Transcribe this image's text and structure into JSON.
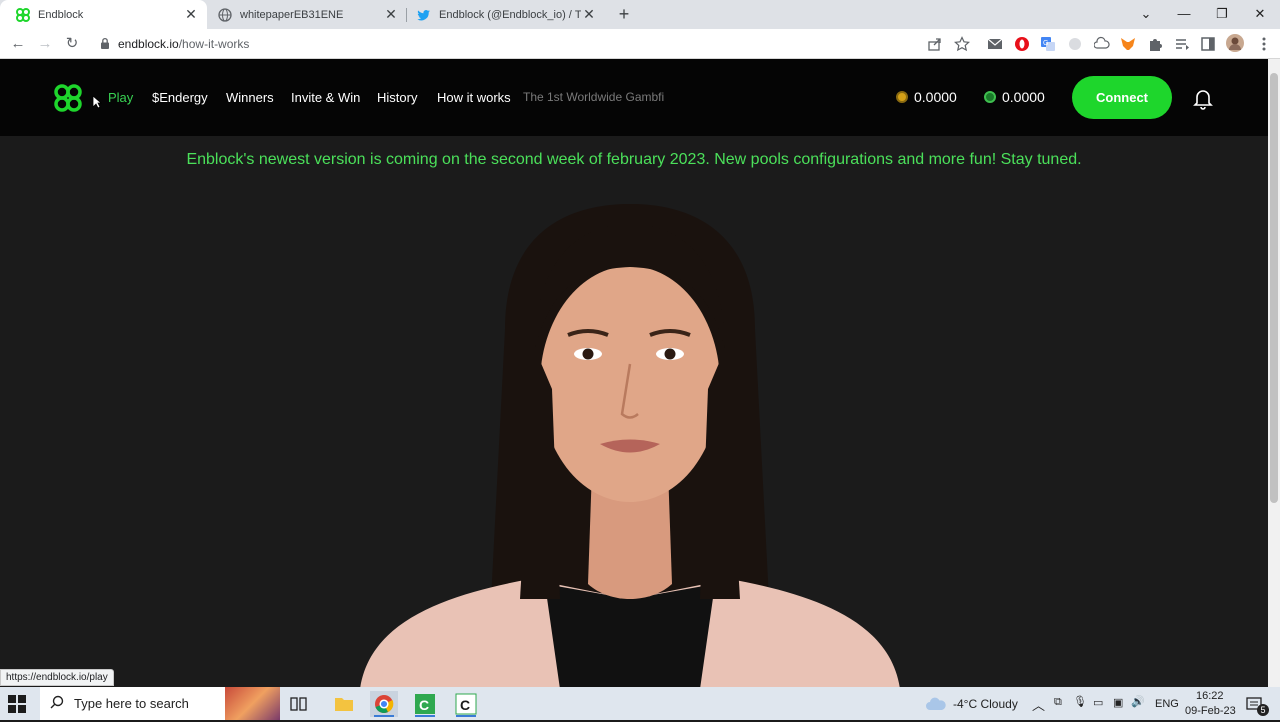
{
  "browser": {
    "tabs": [
      {
        "title": "Endblock",
        "close": "✕"
      },
      {
        "title": "whitepaperEB31ENE",
        "close": "✕"
      },
      {
        "title": "Endblock (@Endblock_io) / Твиттер",
        "close": "✕"
      }
    ],
    "new_tab": "+",
    "url_host": "endblock.io",
    "url_path": "/how-it-works"
  },
  "site": {
    "nav": {
      "play": "Play",
      "endergy": "$Endergy",
      "winners": "Winners",
      "invite": "Invite & Win",
      "history": "History",
      "how": "How it works",
      "tagline": "The 1st Worldwide Gambfi"
    },
    "balances": {
      "gold": "0.0000",
      "green": "0.0000"
    },
    "connect_label": "Connect",
    "banner": "Enblock's newest version is coming on the second week of february 2023. New pools configurations and more fun! Stay tuned.",
    "colors": {
      "accent": "#1ed62c",
      "banner": "#4be05a"
    }
  },
  "status_bar_url": "https://endblock.io/play",
  "taskbar": {
    "search_placeholder": "Type here to search",
    "weather": "-4°C  Cloudy",
    "lang": "ENG",
    "time": "16:22",
    "date": "09-Feb-23",
    "notifications": "5"
  }
}
